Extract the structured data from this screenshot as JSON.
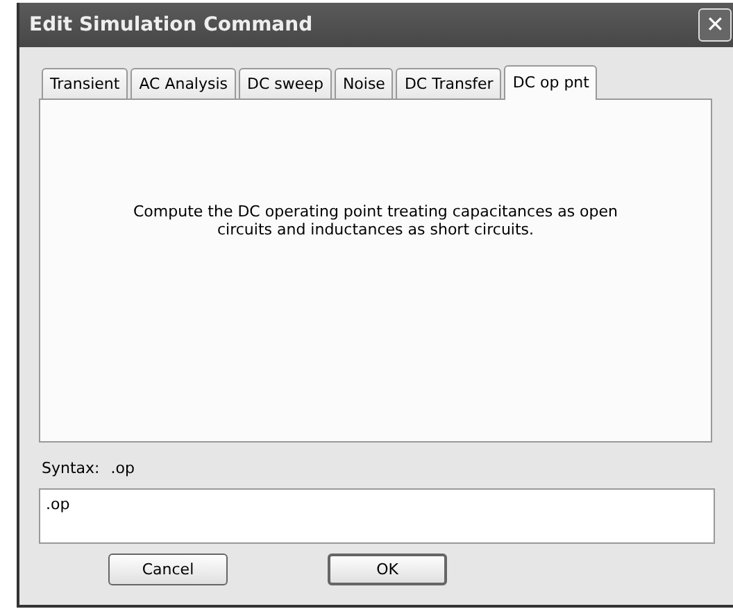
{
  "window": {
    "title": "Edit Simulation Command",
    "close": "✕"
  },
  "tabs": [
    {
      "label": "Transient",
      "selected": false
    },
    {
      "label": "AC Analysis",
      "selected": false
    },
    {
      "label": "DC sweep",
      "selected": false
    },
    {
      "label": "Noise",
      "selected": false
    },
    {
      "label": "DC Transfer",
      "selected": false
    },
    {
      "label": "DC op pnt",
      "selected": true
    }
  ],
  "panel": {
    "description": "Compute the DC operating point treating capacitances as open circuits and inductances as short circuits."
  },
  "syntax": {
    "label": "Syntax:",
    "value": ".op"
  },
  "command": {
    "value": ".op"
  },
  "buttons": [
    {
      "label": "Cancel"
    },
    {
      "label": "OK"
    }
  ]
}
